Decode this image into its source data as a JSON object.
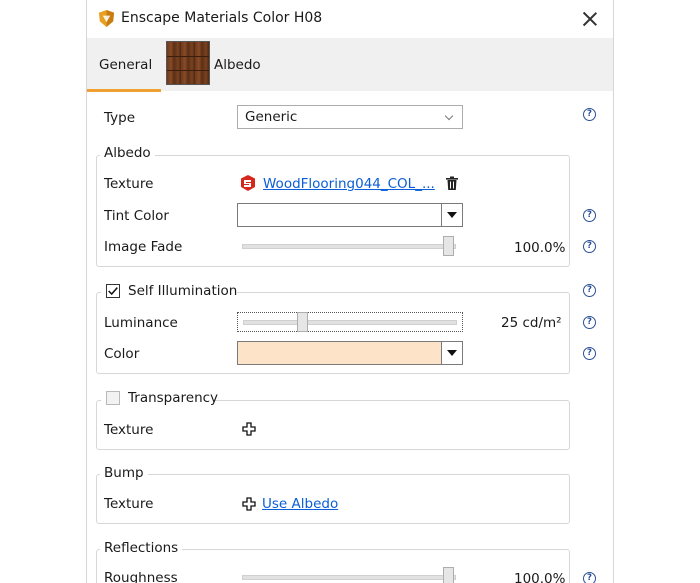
{
  "window": {
    "title": "Enscape Materials Color H08",
    "icon": "enscape-logo-icon",
    "close_icon": "close-icon"
  },
  "tabs": [
    {
      "label": "General",
      "active": true
    },
    {
      "label": "Albedo",
      "active": false,
      "thumbnail": "wood-texture-thumbnail"
    }
  ],
  "accent_color": "#f0a030",
  "general": {
    "type": {
      "label": "Type",
      "value": "Generic"
    }
  },
  "albedo": {
    "title": "Albedo",
    "texture": {
      "label": "Texture",
      "file": "WoodFlooring044_COL_...",
      "file_icon": "sketchup-icon",
      "delete_icon": "trash-icon"
    },
    "tint_color": {
      "label": "Tint Color",
      "color": "#ffffff"
    },
    "image_fade": {
      "label": "Image Fade",
      "value_text": "100.0%",
      "fraction": 1.0
    }
  },
  "self_illumination": {
    "title": "Self Illumination",
    "checked": true,
    "luminance": {
      "label": "Luminance",
      "value_text": "25 cd/m²",
      "fraction": 0.27
    },
    "color": {
      "label": "Color",
      "color": "#fde3c7"
    }
  },
  "transparency": {
    "title": "Transparency",
    "checked": false,
    "texture": {
      "label": "Texture"
    }
  },
  "bump": {
    "title": "Bump",
    "texture": {
      "label": "Texture",
      "link": "Use Albedo"
    }
  },
  "reflections": {
    "title": "Reflections",
    "roughness": {
      "label": "Roughness",
      "value_text": "100.0%",
      "fraction": 1.0
    }
  },
  "help_glyph": "?"
}
